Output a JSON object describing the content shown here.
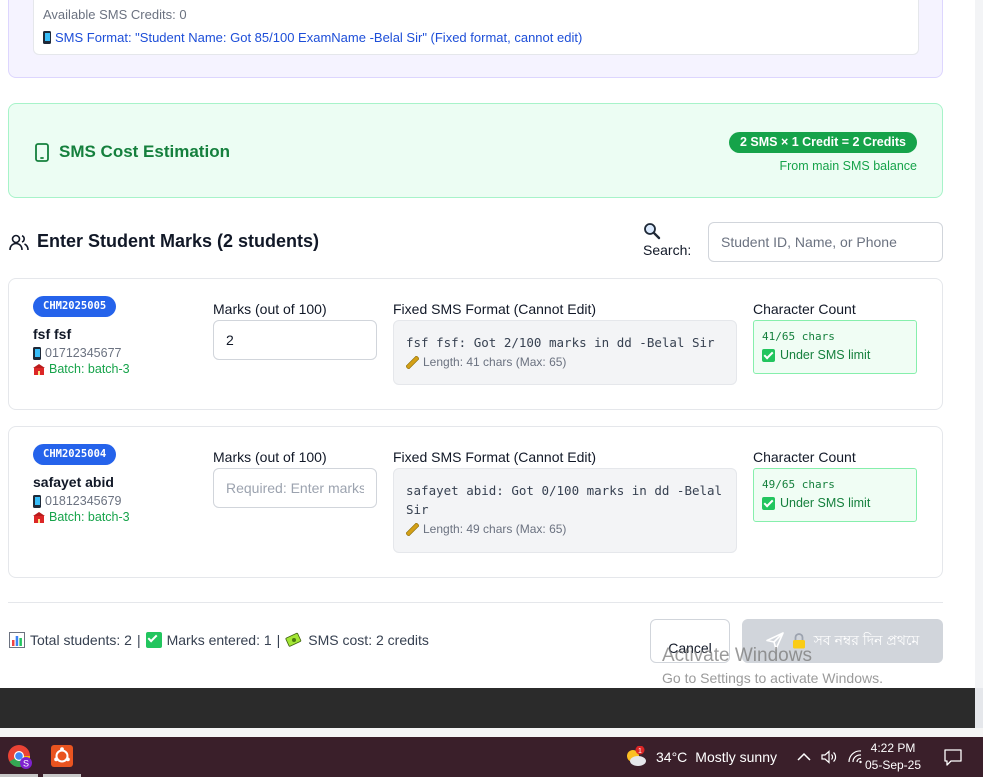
{
  "top_panel": {
    "credits": "Available SMS Credits: 0",
    "sms_format": "SMS Format: \"Student Name: Got 85/100 ExamName -Belal Sir\" (Fixed format, cannot edit)"
  },
  "cost": {
    "title": "SMS Cost Estimation",
    "badge": "2 SMS × 1 Credit = 2 Credits",
    "note": "From main SMS balance"
  },
  "section": {
    "title": "Enter Student Marks (2 students)",
    "search_label": "Search:",
    "search_placeholder": "Student ID, Name, or Phone"
  },
  "labels": {
    "marks": "Marks (out of 100)",
    "sms": "Fixed SMS Format (Cannot Edit)",
    "char_count": "Character Count"
  },
  "students": [
    {
      "id": "CHM2025005",
      "name": "fsf fsf",
      "phone": "01712345677",
      "batch": "Batch: batch-3",
      "marks_value": "2",
      "marks_placeholder": "Required: Enter marks",
      "sms_text": "fsf fsf: Got 2/100 marks in dd -Belal Sir",
      "sms_length": "Length: 41 chars (Max: 65)",
      "char_count": "41/65 chars",
      "char_status": "Under SMS limit"
    },
    {
      "id": "CHM2025004",
      "name": "safayet abid",
      "phone": "01812345679",
      "batch": "Batch: batch-3",
      "marks_value": "",
      "marks_placeholder": "Required: Enter marks",
      "sms_text": "safayet abid: Got 0/100 marks in dd -Belal Sir",
      "sms_length": "Length: 49 chars (Max: 65)",
      "char_count": "49/65 chars",
      "char_status": "Under SMS limit"
    }
  ],
  "footer": {
    "total": "Total students: 2",
    "entered": "Marks entered: 1",
    "cost": "SMS cost: 2 credits",
    "separator": "|",
    "cancel": "Cancel",
    "submit": "সব নম্বর দিন প্রথমে"
  },
  "watermark": {
    "title": "Activate Windows",
    "subtitle": "Go to Settings to activate Windows."
  },
  "taskbar": {
    "weather_badge": "1",
    "temperature": "34°C",
    "condition": "Mostly sunny",
    "time": "4:22 PM",
    "date": "05-Sep-25",
    "profile_letter": "S"
  },
  "colors": {
    "accent_blue": "#2563eb",
    "success_green": "#16a34a",
    "taskbar": "#3a1f2a"
  }
}
